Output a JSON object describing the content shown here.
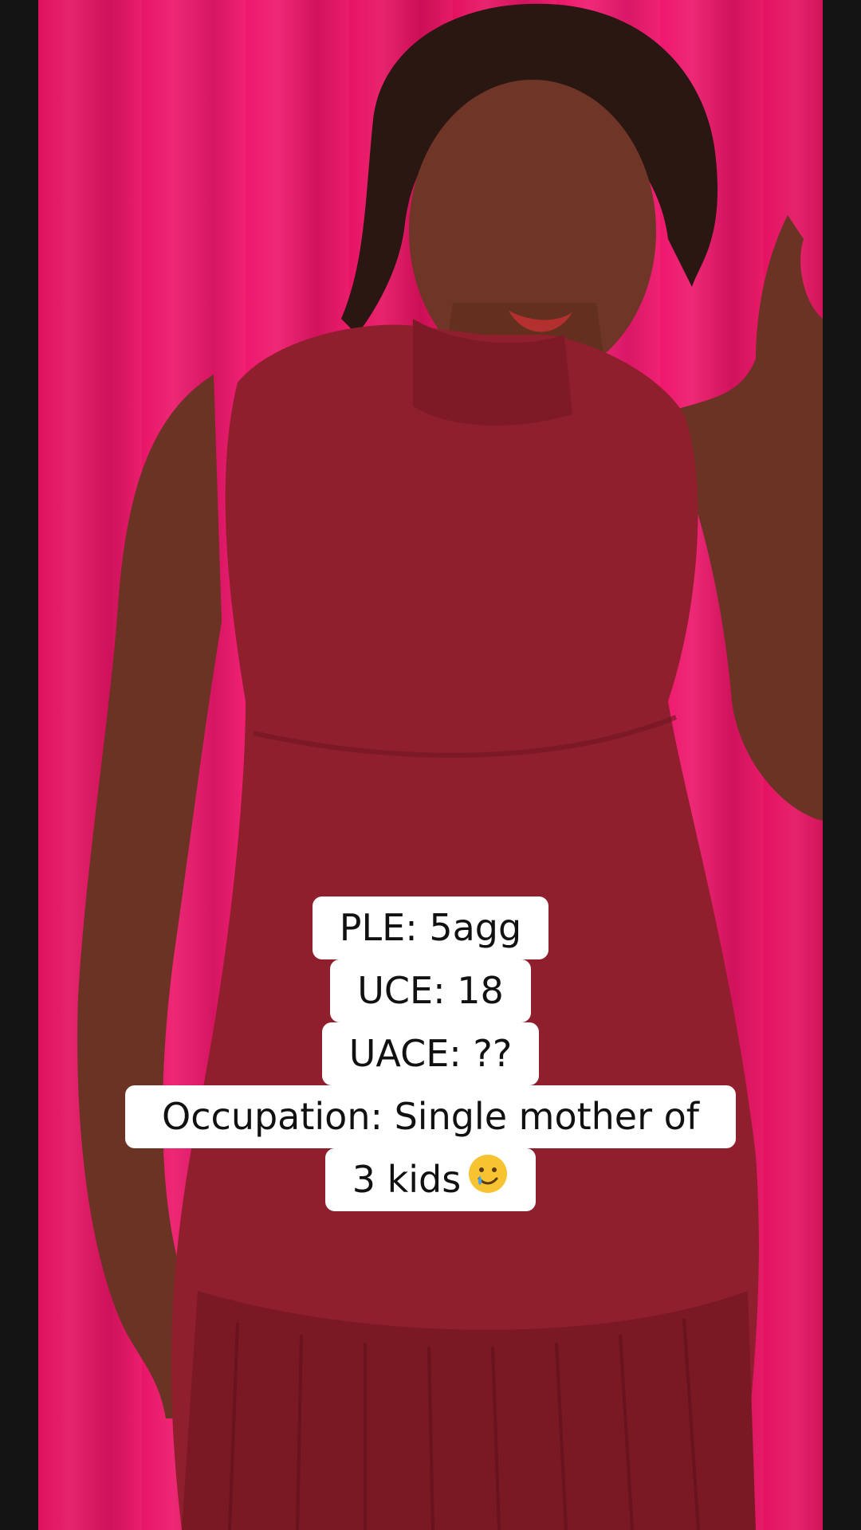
{
  "caption": {
    "lines": [
      "PLE: 5agg",
      "UCE: 18",
      "UACE: ??",
      "Occupation: Single mother of",
      "3 kids"
    ],
    "emoji": "smiling-face-with-tear"
  },
  "colors": {
    "background_curtain": "#e8135f",
    "dress": "#8f1f2c",
    "skin": "#7a3e2e",
    "letterbox": "#141414",
    "caption_box": "#ffffff",
    "caption_text": "#111111"
  }
}
